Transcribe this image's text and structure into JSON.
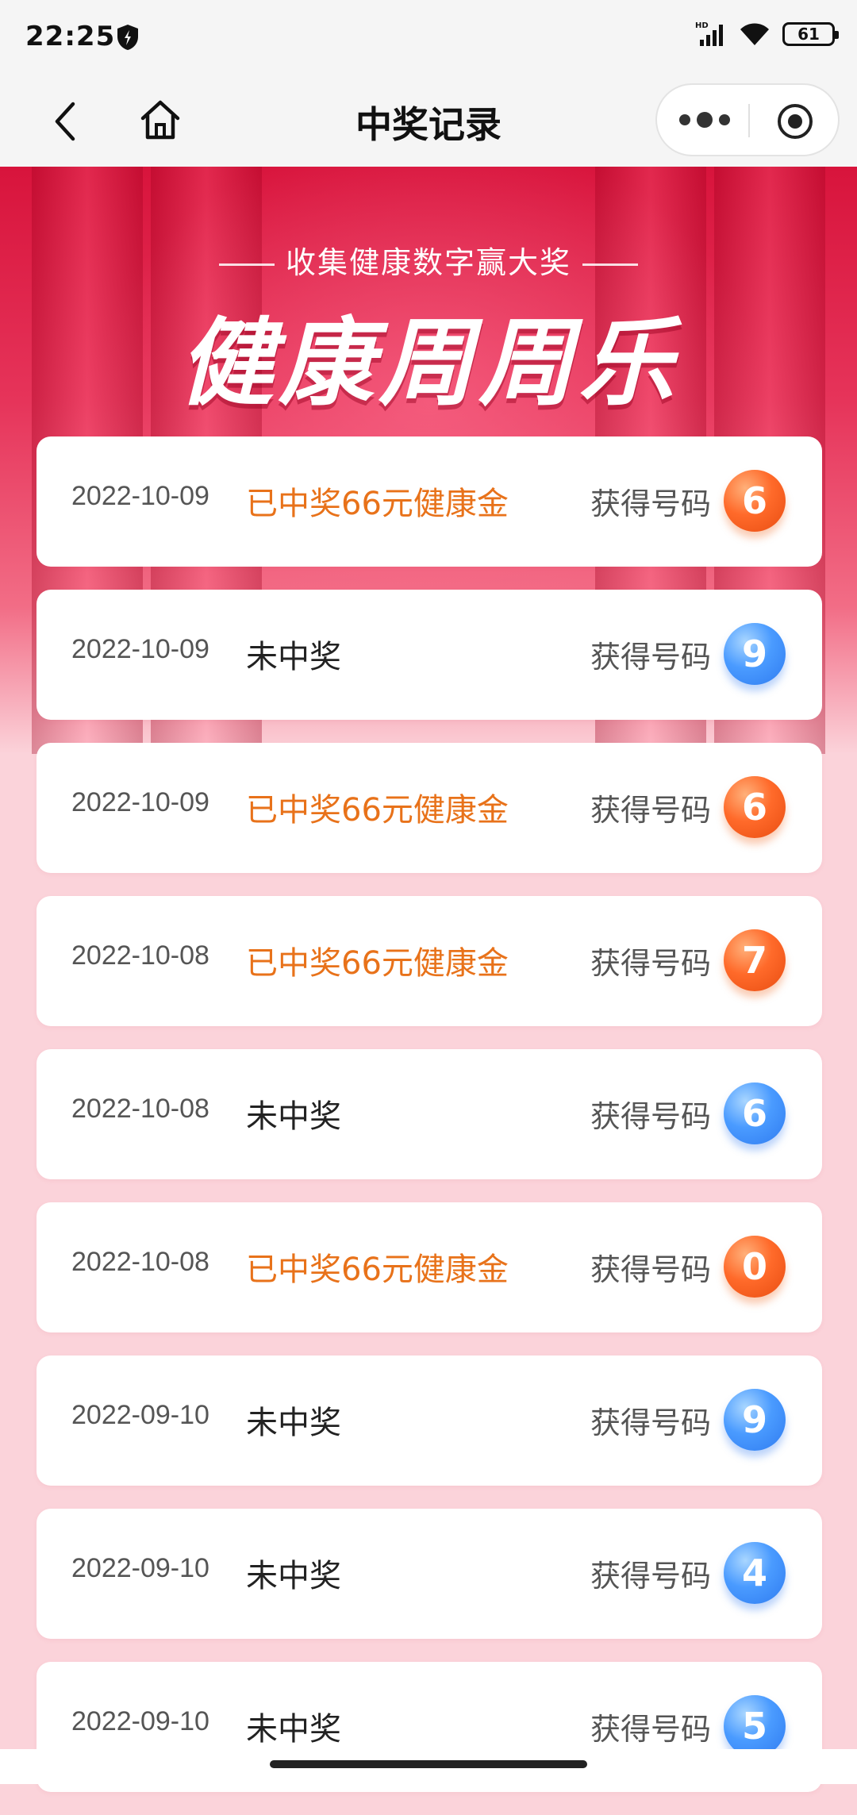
{
  "status_bar": {
    "time": "22:25",
    "network_badge": "HD",
    "battery": "61",
    "icons": [
      "shield-icon",
      "signal-icon",
      "wifi-icon",
      "battery-icon"
    ]
  },
  "nav": {
    "title": "中奖记录",
    "icons": [
      "back-arrow-icon",
      "home-icon",
      "more-dots-icon",
      "close-target-icon"
    ]
  },
  "banner": {
    "subtitle": "收集健康数字赢大奖",
    "title": "健康周周乐"
  },
  "records_label": "获得号码",
  "records": [
    {
      "date": "2022-10-09",
      "status": "已中奖66元健康金",
      "won": true,
      "number": "6",
      "ball_color": "orange"
    },
    {
      "date": "2022-10-09",
      "status": "未中奖",
      "won": false,
      "number": "9",
      "ball_color": "blue"
    },
    {
      "date": "2022-10-09",
      "status": "已中奖66元健康金",
      "won": true,
      "number": "6",
      "ball_color": "orange"
    },
    {
      "date": "2022-10-08",
      "status": "已中奖66元健康金",
      "won": true,
      "number": "7",
      "ball_color": "orange"
    },
    {
      "date": "2022-10-08",
      "status": "未中奖",
      "won": false,
      "number": "6",
      "ball_color": "blue"
    },
    {
      "date": "2022-10-08",
      "status": "已中奖66元健康金",
      "won": true,
      "number": "0",
      "ball_color": "orange"
    },
    {
      "date": "2022-09-10",
      "status": "未中奖",
      "won": false,
      "number": "9",
      "ball_color": "blue"
    },
    {
      "date": "2022-09-10",
      "status": "未中奖",
      "won": false,
      "number": "4",
      "ball_color": "blue"
    },
    {
      "date": "2022-09-10",
      "status": "未中奖",
      "won": false,
      "number": "5",
      "ball_color": "blue"
    }
  ],
  "colors": {
    "won_text": "#e8721a",
    "banner_red": "#d8143c",
    "background_pink": "#fbd3da"
  }
}
